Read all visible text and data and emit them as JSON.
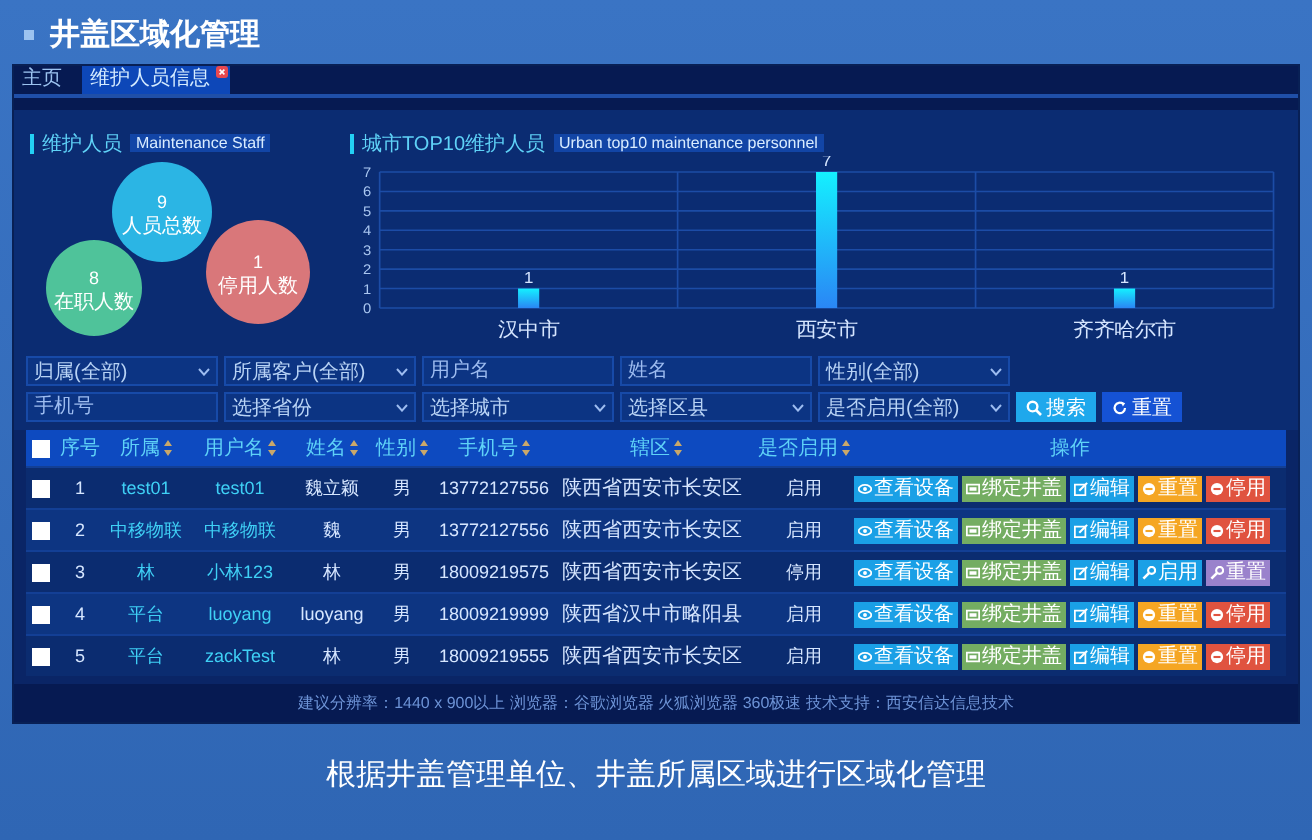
{
  "page_title": "井盖区域化管理",
  "app": {
    "tabs": [
      {
        "label": "主页",
        "selected": false,
        "closable": false
      },
      {
        "label": "维护人员信息",
        "selected": true,
        "closable": true
      }
    ],
    "staff_panel": {
      "title": "维护人员",
      "subtitle": "Maintenance Staff",
      "bubbles": [
        {
          "value": "9",
          "label": "人员总数",
          "color": "#2bb5e4"
        },
        {
          "value": "1",
          "label": "停用人数",
          "color": "#d9777a"
        },
        {
          "value": "8",
          "label": "在职人数",
          "color": "#4fc39a"
        }
      ]
    },
    "city_panel": {
      "title": "城市TOP10维护人员",
      "subtitle": "Urban top10 maintenance personnel",
      "chart_data": {
        "type": "bar",
        "categories": [
          "汉中市",
          "西安市",
          "齐齐哈尔市"
        ],
        "values": [
          1,
          7,
          1
        ],
        "ylim": [
          0,
          7
        ],
        "yticks": [
          0,
          1,
          2,
          3,
          4,
          5,
          6,
          7
        ],
        "data_labels": true,
        "grid": true
      }
    },
    "filters": [
      [
        {
          "kind": "select",
          "value": "归属(全部)"
        },
        {
          "kind": "select",
          "value": "所属客户(全部)"
        },
        {
          "kind": "input",
          "placeholder": "用户名"
        },
        {
          "kind": "input",
          "placeholder": "姓名"
        },
        {
          "kind": "select",
          "value": "性别(全部)"
        }
      ],
      [
        {
          "kind": "input",
          "placeholder": "手机号"
        },
        {
          "kind": "select",
          "value": "选择省份"
        },
        {
          "kind": "select",
          "value": "选择城市"
        },
        {
          "kind": "select",
          "value": "选择区县"
        },
        {
          "kind": "select",
          "value": "是否启用(全部)"
        }
      ]
    ],
    "search_button": "搜索",
    "reset_button": "重置",
    "table": {
      "select_all": {
        "checked": false
      },
      "columns": [
        {
          "label": "序号",
          "sortable": false
        },
        {
          "label": "所属",
          "sortable": true
        },
        {
          "label": "用户名",
          "sortable": true
        },
        {
          "label": "姓名",
          "sortable": true
        },
        {
          "label": "性别",
          "sortable": true
        },
        {
          "label": "手机号",
          "sortable": true
        },
        {
          "label": "辖区",
          "sortable": true
        },
        {
          "label": "是否启用",
          "sortable": true
        },
        {
          "label": "操作",
          "sortable": false
        }
      ],
      "rows": [
        {
          "checked": false,
          "cells": [
            "1",
            "test01",
            "test01",
            "魏立颖",
            "男",
            "13772127556",
            "陕西省西安市长安区",
            "启用"
          ],
          "actions": [
            {
              "kind": "view",
              "label": "查看设备",
              "color": "#1aa0e6"
            },
            {
              "kind": "bind",
              "label": "绑定井盖",
              "color": "#74ad62"
            },
            {
              "kind": "edit",
              "label": "编辑",
              "color": "#1aa0e6"
            },
            {
              "kind": "reset",
              "label": "重置",
              "color": "#f5a623"
            },
            {
              "kind": "disable",
              "label": "停用",
              "color": "#e0533f"
            }
          ]
        },
        {
          "checked": false,
          "cells": [
            "2",
            "中移物联",
            "中移物联",
            "魏",
            "男",
            "13772127556",
            "陕西省西安市长安区",
            "启用"
          ],
          "actions": [
            {
              "kind": "view",
              "label": "查看设备",
              "color": "#1aa0e6"
            },
            {
              "kind": "bind",
              "label": "绑定井盖",
              "color": "#74ad62"
            },
            {
              "kind": "edit",
              "label": "编辑",
              "color": "#1aa0e6"
            },
            {
              "kind": "reset",
              "label": "重置",
              "color": "#f5a623"
            },
            {
              "kind": "disable",
              "label": "停用",
              "color": "#e0533f"
            }
          ]
        },
        {
          "checked": false,
          "cells": [
            "3",
            "林",
            "小林123",
            "林",
            "男",
            "18009219575",
            "陕西省西安市长安区",
            "停用"
          ],
          "actions": [
            {
              "kind": "view",
              "label": "查看设备",
              "color": "#1aa0e6"
            },
            {
              "kind": "bind",
              "label": "绑定井盖",
              "color": "#74ad62"
            },
            {
              "kind": "edit",
              "label": "编辑",
              "color": "#1aa0e6"
            },
            {
              "kind": "enable",
              "label": "启用",
              "color": "#1aa0e6"
            },
            {
              "kind": "enable",
              "label": "重置",
              "color": "#9a82cc"
            }
          ]
        },
        {
          "checked": false,
          "cells": [
            "4",
            "平台",
            "luoyang",
            "luoyang",
            "男",
            "18009219999",
            "陕西省汉中市略阳县",
            "启用"
          ],
          "actions": [
            {
              "kind": "view",
              "label": "查看设备",
              "color": "#1aa0e6"
            },
            {
              "kind": "bind",
              "label": "绑定井盖",
              "color": "#74ad62"
            },
            {
              "kind": "edit",
              "label": "编辑",
              "color": "#1aa0e6"
            },
            {
              "kind": "reset",
              "label": "重置",
              "color": "#f5a623"
            },
            {
              "kind": "disable",
              "label": "停用",
              "color": "#e0533f"
            }
          ]
        },
        {
          "checked": false,
          "cells": [
            "5",
            "平台",
            "zackTest",
            "林",
            "男",
            "18009219555",
            "陕西省西安市长安区",
            "启用"
          ],
          "actions": [
            {
              "kind": "view",
              "label": "查看设备",
              "color": "#1aa0e6"
            },
            {
              "kind": "bind",
              "label": "绑定井盖",
              "color": "#74ad62"
            },
            {
              "kind": "edit",
              "label": "编辑",
              "color": "#1aa0e6"
            },
            {
              "kind": "reset",
              "label": "重置",
              "color": "#f5a623"
            },
            {
              "kind": "disable",
              "label": "停用",
              "color": "#e0533f"
            }
          ]
        }
      ]
    },
    "footer": "建议分辨率：1440 x 900以上  浏览器：谷歌浏览器 火狐浏览器 360极速  技术支持：西安信达信息技术"
  },
  "caption": "根据井盖管理单位、井盖所属区域进行区域化管理"
}
